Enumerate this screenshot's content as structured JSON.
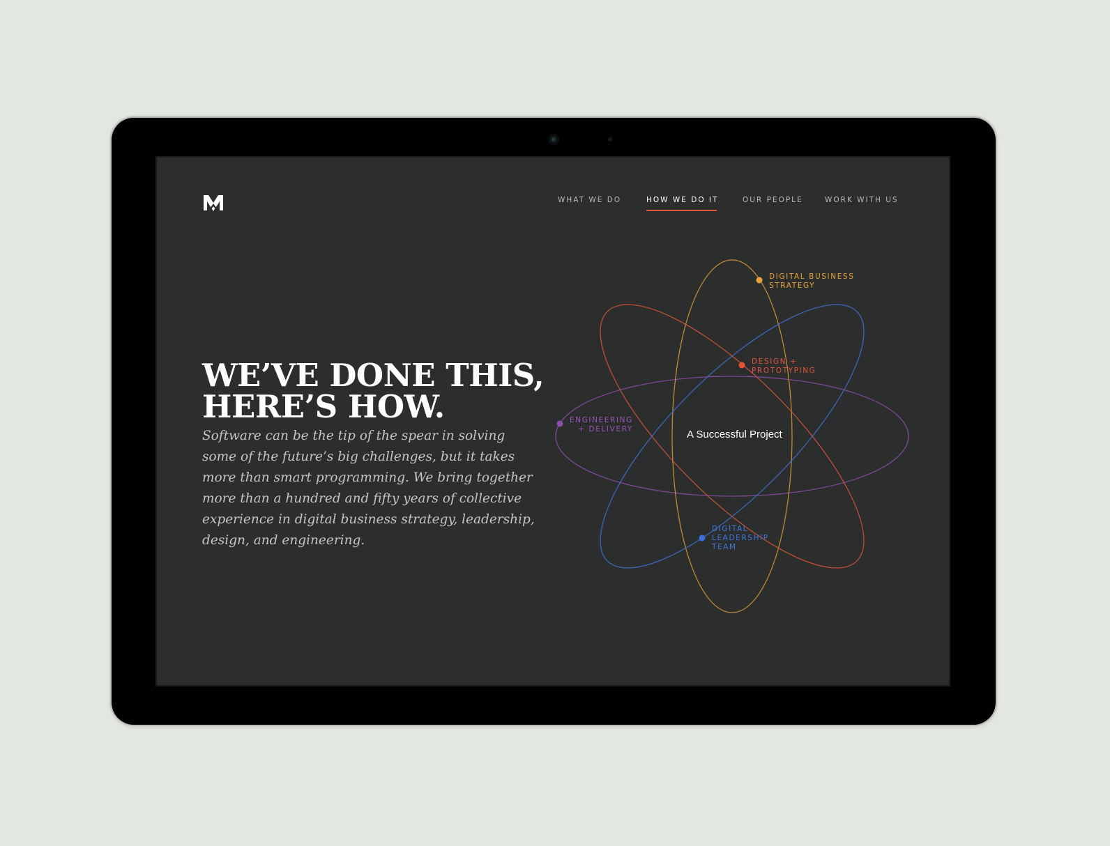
{
  "nav": {
    "items": [
      {
        "label": "WHAT WE DO",
        "active": false
      },
      {
        "label": "HOW WE DO IT",
        "active": true
      },
      {
        "label": "OUR PEOPLE",
        "active": false
      },
      {
        "label": "WORK WITH US",
        "active": false
      }
    ]
  },
  "hero": {
    "headline_line1": "WE’VE DONE THIS,",
    "headline_line2": "HERE’S HOW.",
    "body": "Software can be the tip of the spear in solving some of the future’s big challenges, but it takes more than smart programming. We bring together more than a hundred and fifty years of collective experience in digital business strategy, leadership, design, and engineering."
  },
  "diagram": {
    "center_label": "A Successful Project",
    "orbits": [
      {
        "label": "DIGITAL BUSINESS\nSTRATEGY",
        "color": "#e9a23b"
      },
      {
        "label": "DESIGN +\nPROTOTYPING",
        "color": "#e4533a"
      },
      {
        "label": "ENGINEERING\n+ DELIVERY",
        "color": "#8e4ca8"
      },
      {
        "label": "DIGITAL\nLEADERSHIP\nTEAM",
        "color": "#3a6fd8"
      }
    ]
  },
  "colors": {
    "background": "#e2e7df",
    "screen": "#2b2e2d",
    "accent": "#e4533a"
  }
}
